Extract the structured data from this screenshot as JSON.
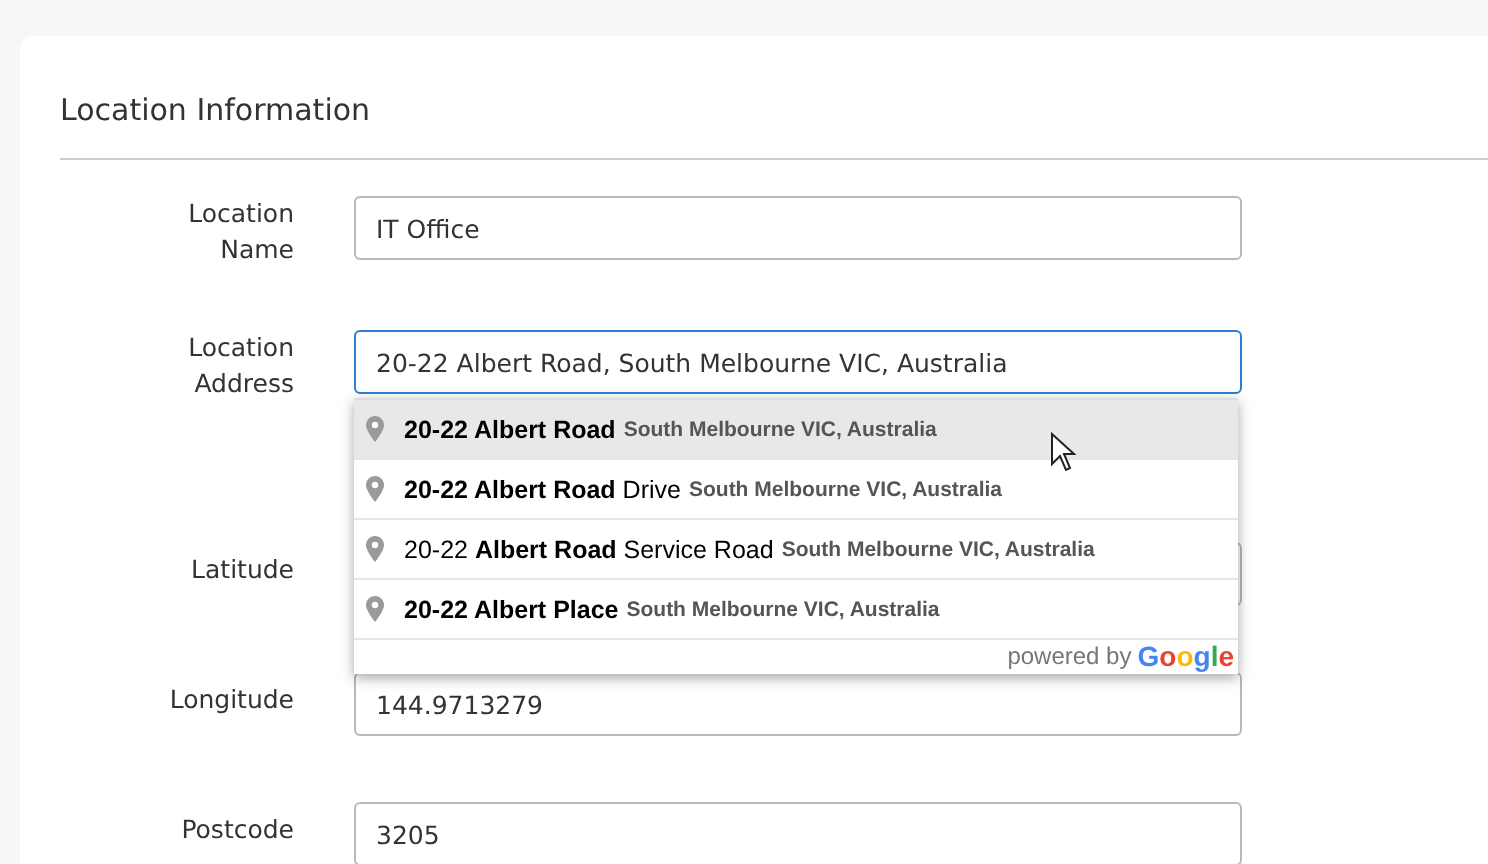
{
  "section": {
    "title": "Location Information"
  },
  "fields": [
    {
      "kind": "text",
      "label": "Location Name",
      "value": "IT Office",
      "focused": false
    },
    {
      "kind": "address",
      "label": "Location Address",
      "value": "20-22 Albert Road, South Melbourne VIC, Australia",
      "focused": true,
      "suggestions": [
        {
          "main": "**20-22 Albert Road**",
          "secondary": "South Melbourne VIC, Australia",
          "selected": true
        },
        {
          "main": "**20-22 Albert Road** Drive",
          "secondary": "South Melbourne VIC, Australia",
          "selected": false
        },
        {
          "main": "20-22 **Albert Road** Service Road",
          "secondary": "South Melbourne VIC, Australia",
          "selected": false
        },
        {
          "main": "**20-22 Albert Place**",
          "secondary": "South Melbourne VIC, Australia",
          "selected": false
        }
      ],
      "attribution": {
        "text": "powered by",
        "brand": "Google"
      }
    },
    {
      "kind": "text",
      "label": "Latitude",
      "focused": false
    },
    {
      "kind": "text",
      "label": "Longitude",
      "value": "144.9713279",
      "focused": false
    },
    {
      "kind": "text",
      "label": "Postcode",
      "value": "3205",
      "focused": false
    }
  ]
}
